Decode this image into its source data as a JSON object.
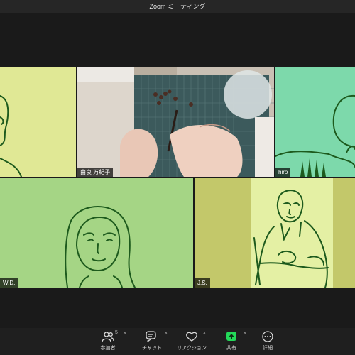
{
  "window": {
    "title": "Zoom ミーティング"
  },
  "participants": [
    {
      "name": ""
    },
    {
      "name": "由良 万紀子"
    },
    {
      "name": "hiro"
    },
    {
      "name": "W.D."
    },
    {
      "name": "J.S."
    }
  ],
  "toolbar": {
    "participants": {
      "label": "参加者",
      "count": "5",
      "icon": "participants-icon"
    },
    "chat": {
      "label": "チャット",
      "icon": "chat-icon"
    },
    "reaction": {
      "label": "リアクション",
      "icon": "heart-icon"
    },
    "share": {
      "label": "共有",
      "icon": "share-screen-icon",
      "color": "#23d959"
    },
    "more": {
      "label": "詳細",
      "icon": "more-icon"
    },
    "caret": "^"
  },
  "colors": {
    "tile_yellow": "#e0e895",
    "tile_teal": "#7dd9ab",
    "tile_green": "#a5d585",
    "tile_olive": "#c3c86a",
    "line": "#1d5a1d"
  }
}
